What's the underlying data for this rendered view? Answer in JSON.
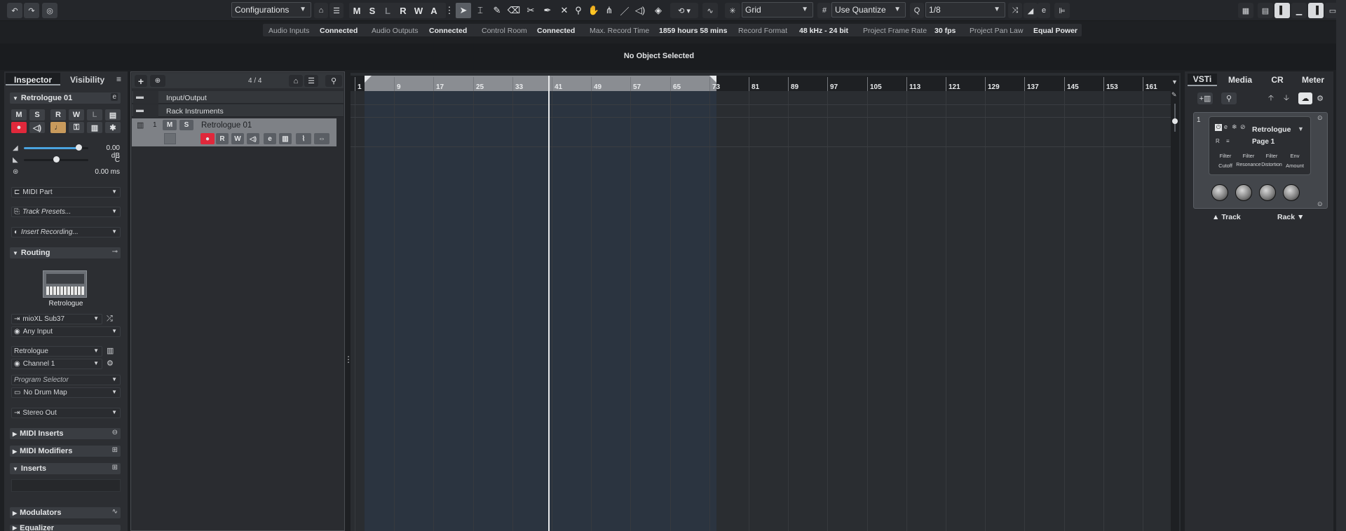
{
  "toolbar": {
    "configurations": "Configurations",
    "modes": [
      "M",
      "S",
      "L",
      "R",
      "W",
      "A"
    ],
    "snap_type": "Grid",
    "quantize_mode": "Use Quantize",
    "quantize_value": "1/8"
  },
  "status": [
    {
      "label": "Audio Inputs",
      "value": "Connected"
    },
    {
      "label": "Audio Outputs",
      "value": "Connected"
    },
    {
      "label": "Control Room",
      "value": "Connected"
    },
    {
      "label": "Max. Record Time",
      "value": "1859 hours 58 mins"
    },
    {
      "label": "Record Format",
      "value": "48 kHz - 24 bit"
    },
    {
      "label": "Project Frame Rate",
      "value": "30 fps"
    },
    {
      "label": "Project Pan Law",
      "value": "Equal Power"
    }
  ],
  "info_line": "No Object Selected",
  "inspector": {
    "tabs": [
      "Inspector",
      "Visibility"
    ],
    "track_name": "Retrologue 01",
    "buttons": [
      "M",
      "S",
      "R",
      "W",
      "L"
    ],
    "volume": "0.00 dB",
    "pan": "C",
    "delay": "0.00 ms",
    "volume_level": 0.85,
    "pan_level": 0.5,
    "midi_part": "MIDI Part",
    "track_presets": "Track Presets...",
    "insert_recording": "Insert Recording...",
    "routing_label": "Routing",
    "instrument_name": "Retrologue",
    "input_device": "mioXL Sub37",
    "input_sub": "Any Input",
    "output_instrument": "Retrologue",
    "channel": "Channel 1",
    "program_selector": "Program Selector",
    "drum_map": "No Drum Map",
    "stereo_out": "Stereo Out",
    "sections": [
      "MIDI Inserts",
      "MIDI Modifiers",
      "Inserts",
      "Modulators",
      "Equalizer"
    ]
  },
  "tracklist": {
    "count": "4 / 4",
    "folders": [
      "Input/Output",
      "Rack Instruments"
    ],
    "track_number": "1",
    "track_name": "Retrologue 01",
    "track_buttons": [
      "M",
      "S"
    ],
    "track_row2": [
      "R",
      "W"
    ]
  },
  "ruler": {
    "bars": [
      "1",
      "9",
      "17",
      "25",
      "33",
      "41",
      "49",
      "57",
      "65",
      "73",
      "81",
      "89",
      "97",
      "105",
      "113",
      "121",
      "129",
      "137",
      "145",
      "153",
      "161"
    ],
    "locator_left": "1",
    "locator_right": "73",
    "cursor_bar": "41"
  },
  "rightzone": {
    "tabs": [
      "VSTi",
      "Media",
      "CR",
      "Meter"
    ],
    "slot_number": "1",
    "plugin_name": "Retrologue",
    "page": "Page 1",
    "param_labels_top": [
      "Filter",
      "Filter",
      "Filter",
      "Env"
    ],
    "param_labels_bottom": [
      "Cutoff",
      "Resonance",
      "Distortion",
      "Amount"
    ],
    "track_label": "Track",
    "rack_label": "Rack"
  },
  "colors": {
    "accent_record": "#e0283b",
    "locator_region": "#2b3440",
    "toolbar_bg": "#24262a"
  }
}
